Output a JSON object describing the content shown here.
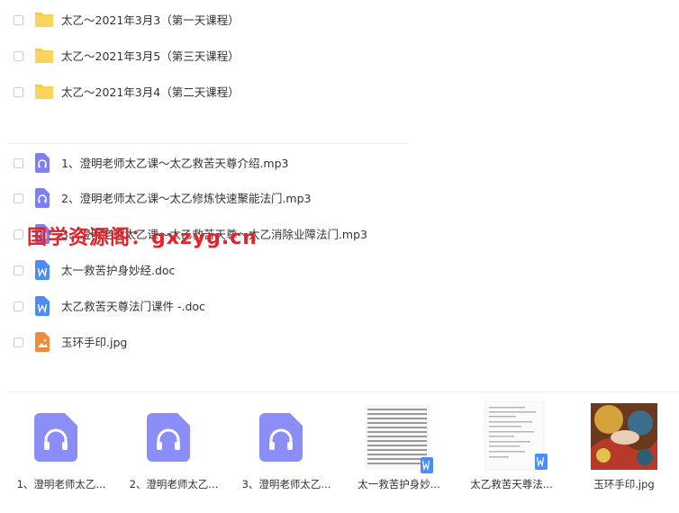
{
  "folders": [
    {
      "name": "太乙～2021年3月3（第一天课程）"
    },
    {
      "name": "太乙～2021年3月5（第三天课程）"
    },
    {
      "name": "太乙～2021年3月4（第二天课程）"
    }
  ],
  "files": [
    {
      "name": "1、澄明老师太乙课～太乙救苦天尊介绍.mp3",
      "type": "audio-icon"
    },
    {
      "name": "2、澄明老师太乙课～太乙修炼快速聚能法门.mp3",
      "type": "audio-icon"
    },
    {
      "name": "3、澄明老师太乙课～太乙救苦天尊～太乙消除业障法门.mp3",
      "type": "audio-icon"
    },
    {
      "name": "太一救苦护身妙经.doc",
      "type": "doc-icon"
    },
    {
      "name": "太乙救苦天尊法门课件 -.doc",
      "type": "doc-icon"
    },
    {
      "name": "玉环手印.jpg",
      "type": "image-icon"
    }
  ],
  "thumbnails": [
    {
      "label": "1、澄明老师太乙..."
    },
    {
      "label": "2、澄明老师太乙..."
    },
    {
      "label": "3、澄明老师太乙..."
    },
    {
      "label": "太一救苦护身妙..."
    },
    {
      "label": "太乙救苦天尊法..."
    },
    {
      "label": "玉环手印.jpg"
    }
  ],
  "watermark": "国学资源阁：gxzyg.cn",
  "colors": {
    "folder": "#f7c948",
    "audio": "#7c7ff5",
    "doc": "#4a8df8",
    "image": "#f08a3c",
    "watermark": "#e3232a"
  }
}
